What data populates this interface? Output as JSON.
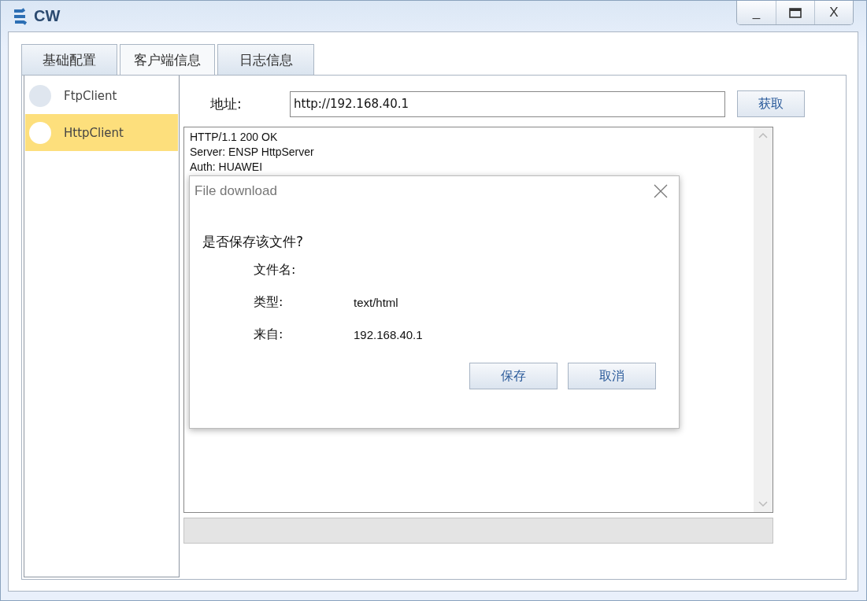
{
  "window": {
    "title": "CW",
    "controls": [
      "_",
      "X"
    ]
  },
  "tabs": [
    {
      "label": "基础配置",
      "selected": false
    },
    {
      "label": "客户端信息",
      "selected": true
    },
    {
      "label": "日志信息",
      "selected": false
    }
  ],
  "clients": [
    {
      "name": "FtpClient",
      "selected": false
    },
    {
      "name": "HttpClient",
      "selected": true
    }
  ],
  "address": {
    "label": "地址:",
    "value": "http://192.168.40.1",
    "button": "获取"
  },
  "response": [
    "HTTP/1.1 200 OK",
    "Server: ENSP HttpServer",
    "Auth: HUAWEI"
  ],
  "dialog": {
    "title": "File download",
    "question": "是否保存该文件?",
    "fields": [
      {
        "label": "文件名:"
      },
      {
        "label": "类型:",
        "value": "text/html"
      },
      {
        "label": "来自:",
        "value": "192.168.40.1"
      }
    ],
    "buttons": [
      "保存",
      "取消"
    ]
  }
}
